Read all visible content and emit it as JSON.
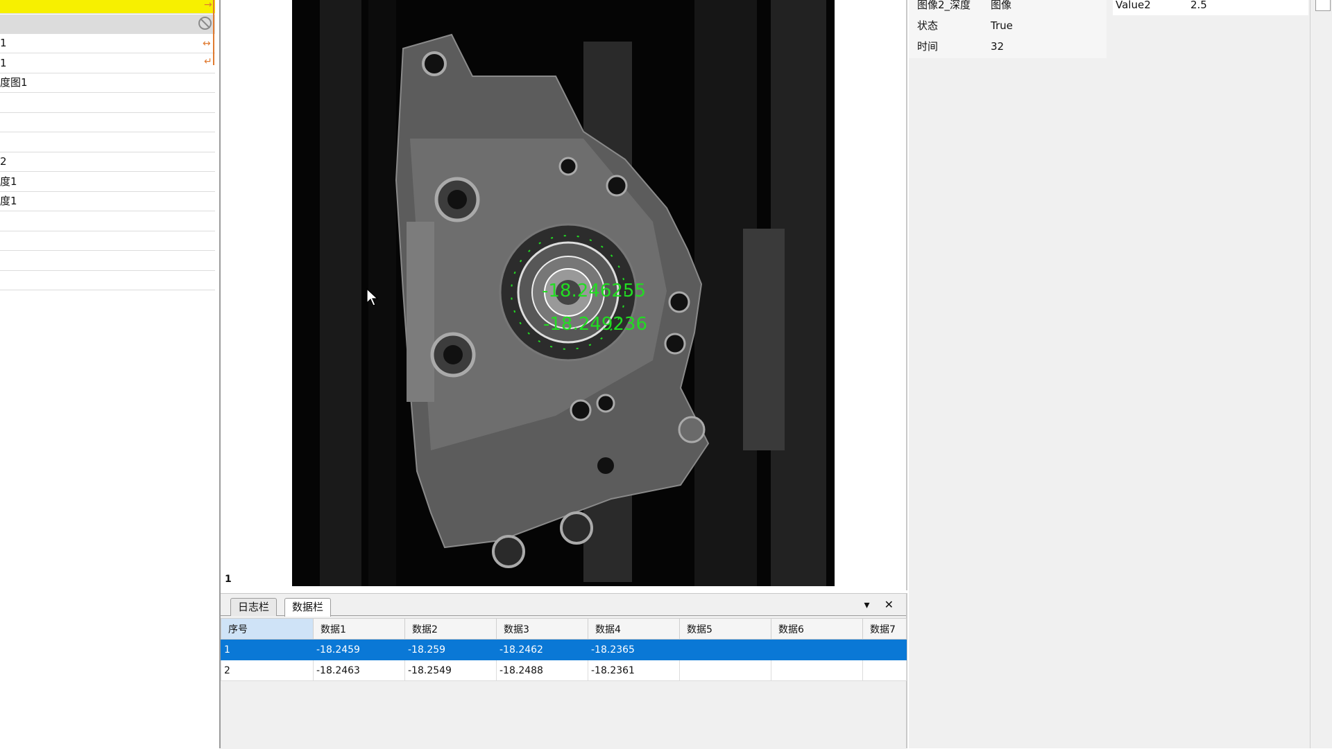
{
  "flow_list": {
    "rows": [
      {
        "label": "",
        "style": "highlight"
      },
      {
        "label": "",
        "style": "disabled"
      },
      {
        "label": "1",
        "style": "normal"
      },
      {
        "label": "1",
        "style": "normal"
      },
      {
        "label": "度图1",
        "style": "normal"
      },
      {
        "label": "",
        "style": "normal"
      },
      {
        "label": "",
        "style": "normal"
      },
      {
        "label": "",
        "style": "normal"
      },
      {
        "label": "2",
        "style": "normal"
      },
      {
        "label": "度1",
        "style": "normal"
      },
      {
        "label": "度1",
        "style": "normal"
      },
      {
        "label": "",
        "style": "normal"
      },
      {
        "label": "",
        "style": "normal"
      },
      {
        "label": "",
        "style": "normal"
      },
      {
        "label": "",
        "style": "normal"
      }
    ],
    "icons": {
      "disabled": "disabled-circle-icon",
      "link_arrow": "arrow-icon"
    }
  },
  "image_view": {
    "index_label": "1",
    "overlay_texts": [
      "-18.246255",
      "-18.249236"
    ],
    "overlay_color": "#22dd22"
  },
  "bottom_panel": {
    "tabs": [
      {
        "label": "日志栏",
        "active": false
      },
      {
        "label": "数据栏",
        "active": true
      }
    ],
    "controls": {
      "dropdown": "▾",
      "close": "✕"
    },
    "table": {
      "headers": [
        "序号",
        "数据1",
        "数据2",
        "数据3",
        "数据4",
        "数据5",
        "数据6",
        "数据7"
      ],
      "rows": [
        {
          "cells": [
            "1",
            "-18.2459",
            "-18.259",
            "-18.2462",
            "-18.2365",
            "",
            "",
            ""
          ],
          "selected": true
        },
        {
          "cells": [
            "2",
            "-18.2463",
            "-18.2549",
            "-18.2488",
            "-18.2361",
            "",
            "",
            ""
          ],
          "selected": false
        }
      ],
      "selection_color": "#0a78d6"
    }
  },
  "properties": {
    "rows": [
      {
        "key": "图像2_深度",
        "value": "图像"
      },
      {
        "key": "状态",
        "value": "True"
      },
      {
        "key": "时间",
        "value": "32"
      }
    ]
  },
  "properties_2": {
    "rows": [
      {
        "key": "Value2",
        "value": "2.5"
      }
    ]
  },
  "colors": {
    "flow_highlight": "#f7f000",
    "link_accent": "#e07a30"
  }
}
